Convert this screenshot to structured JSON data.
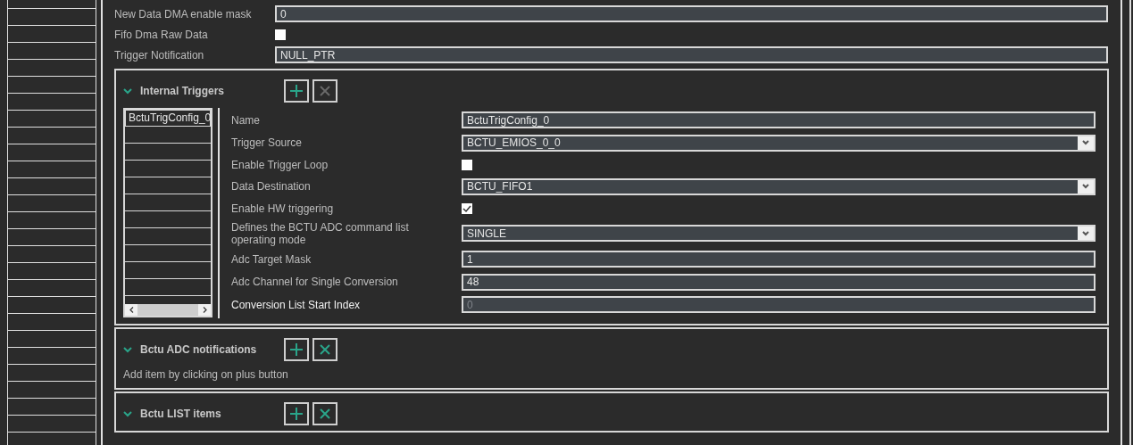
{
  "fields": [
    {
      "kind": "text",
      "label": "New Data DMA enable mask",
      "value": "0"
    },
    {
      "kind": "checkbox",
      "label": "Fifo Dma Raw Data",
      "checked": false
    },
    {
      "kind": "text",
      "label": "Trigger Notification",
      "value": "NULL_PTR"
    }
  ],
  "sections": [
    {
      "title": "Internal Triggers",
      "expanded": true,
      "remove_disabled": true,
      "list": [
        {
          "label": "BctuTrigConfig_0",
          "selected": true
        }
      ],
      "properties": [
        {
          "kind": "text",
          "label": "Name",
          "value": "BctuTrigConfig_0",
          "disabled": false
        },
        {
          "kind": "select",
          "label": "Trigger Source",
          "value": "BCTU_EMIOS_0_0",
          "disabled": false
        },
        {
          "kind": "checkbox",
          "label": "Enable Trigger Loop",
          "checked": false
        },
        {
          "kind": "select",
          "label": "Data Destination",
          "value": "BCTU_FIFO1",
          "disabled": false
        },
        {
          "kind": "checkbox",
          "label": "Enable HW triggering",
          "checked": true
        },
        {
          "kind": "select",
          "label": "Defines the BCTU ADC command list operating mode",
          "value": "SINGLE",
          "disabled": false
        },
        {
          "kind": "text",
          "label": "Adc Target Mask",
          "value": "1",
          "disabled": false
        },
        {
          "kind": "text",
          "label": "Adc Channel for Single Conversion",
          "value": "48",
          "disabled": false
        },
        {
          "kind": "text",
          "label": "Conversion List Start Index",
          "value": "0",
          "disabled": true
        }
      ]
    },
    {
      "title": "Bctu ADC notifications",
      "expanded": true,
      "remove_disabled": false,
      "hint": "Add item by clicking on plus button"
    },
    {
      "title": "Bctu LIST items",
      "expanded": true,
      "remove_disabled": false
    }
  ]
}
